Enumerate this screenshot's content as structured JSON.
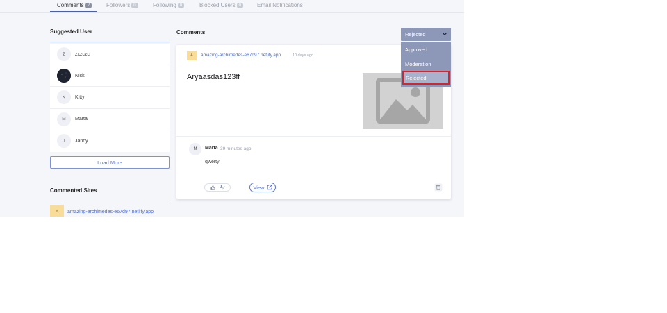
{
  "tabs": [
    {
      "label": "Comments",
      "count": "2"
    },
    {
      "label": "Followers",
      "count": "0"
    },
    {
      "label": "Following",
      "count": "0"
    },
    {
      "label": "Blocked Users",
      "count": "0"
    },
    {
      "label": "Email Notifications"
    }
  ],
  "suggested": {
    "title": "Suggested User",
    "users": [
      {
        "initial": "Z",
        "name": "zxzczc"
      },
      {
        "initial": "",
        "name": "Nick"
      },
      {
        "initial": "K",
        "name": "Kitty"
      },
      {
        "initial": "M",
        "name": "Marta"
      },
      {
        "initial": "J",
        "name": "Janny"
      }
    ],
    "load_more": "Load More"
  },
  "sites": {
    "title": "Commented Sites",
    "items": [
      {
        "initial": "A",
        "name": "amazing-archimedes-e67d97.netlify.app"
      }
    ]
  },
  "comments": {
    "title": "Comments",
    "filter": {
      "selected": "Rejected",
      "options": [
        "Approved",
        "Moderation",
        "Rejected"
      ]
    },
    "card": {
      "site_initial": "A",
      "site": "amazing-archimedes-e67d97.netlify.app",
      "time": "10 days ago",
      "post_title": "Aryaasdas123ff",
      "comment": {
        "initial": "M",
        "author": "Marta",
        "time": "39 minutes ago",
        "text": "qwerty"
      },
      "view_label": "View"
    }
  },
  "icons": [
    "thumbs-up-icon",
    "thumbs-down-icon",
    "external-link-icon",
    "trash-icon",
    "chevron-down-icon",
    "image-placeholder-icon"
  ],
  "colors": {
    "accent": "#4a6bd0",
    "dropdown": "#8d97b8",
    "highlight": "#d9232a"
  }
}
